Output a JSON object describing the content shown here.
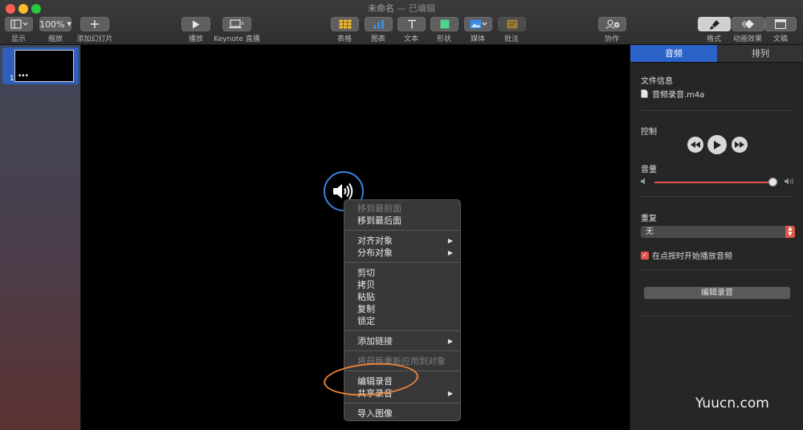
{
  "window": {
    "title": "未命名",
    "subtitle": " — 已编辑"
  },
  "toolbar": {
    "view_label": "显示",
    "zoom_value": "100%",
    "zoom_label": "缩放",
    "add_slide_label": "添加幻灯片",
    "play_label": "播放",
    "keynote_live_label": "Keynote 直播",
    "table_label": "表格",
    "chart_label": "图表",
    "text_label": "文本",
    "shape_label": "形状",
    "media_label": "媒体",
    "comment_label": "批注",
    "collaborate_label": "协作",
    "format_label": "格式",
    "animate_label": "动画效果",
    "document_label": "文稿"
  },
  "navigator": {
    "slide_number": "1",
    "slide_dots": "•••"
  },
  "context_menu": {
    "items": [
      {
        "label": "移到最前面",
        "enabled": false
      },
      {
        "label": "移到最后面",
        "enabled": true
      },
      {
        "label": "对齐对象",
        "enabled": true,
        "submenu": true
      },
      {
        "label": "分布对象",
        "enabled": true,
        "submenu": true
      },
      {
        "label": "剪切",
        "enabled": true
      },
      {
        "label": "拷贝",
        "enabled": true
      },
      {
        "label": "粘贴",
        "enabled": true
      },
      {
        "label": "复制",
        "enabled": true
      },
      {
        "label": "锁定",
        "enabled": true
      },
      {
        "label": "添加链接",
        "enabled": true,
        "submenu": true
      },
      {
        "label": "将母版重新应用到对象",
        "enabled": false
      },
      {
        "label": "编辑录音",
        "enabled": true
      },
      {
        "label": "共享录音",
        "enabled": true,
        "submenu": true
      },
      {
        "label": "导入图像",
        "enabled": true
      }
    ]
  },
  "inspector": {
    "tabs": [
      "音频",
      "排列"
    ],
    "active_tab": "音频",
    "file_info_title": "文件信息",
    "file_name": "音频录音.m4a",
    "controls_title": "控制",
    "volume_title": "音量",
    "volume_level": 0.97,
    "repeat_title": "重复",
    "repeat_value": "无",
    "start_on_click_label": "在点按时开始播放音频",
    "start_on_click_checked": true,
    "edit_recording_label": "编辑录音"
  },
  "colors": {
    "accent_blue": "#2b63c9",
    "slider_red": "#e0544a",
    "highlight_orange": "#e8833a"
  },
  "watermark": "Yuucn.com"
}
